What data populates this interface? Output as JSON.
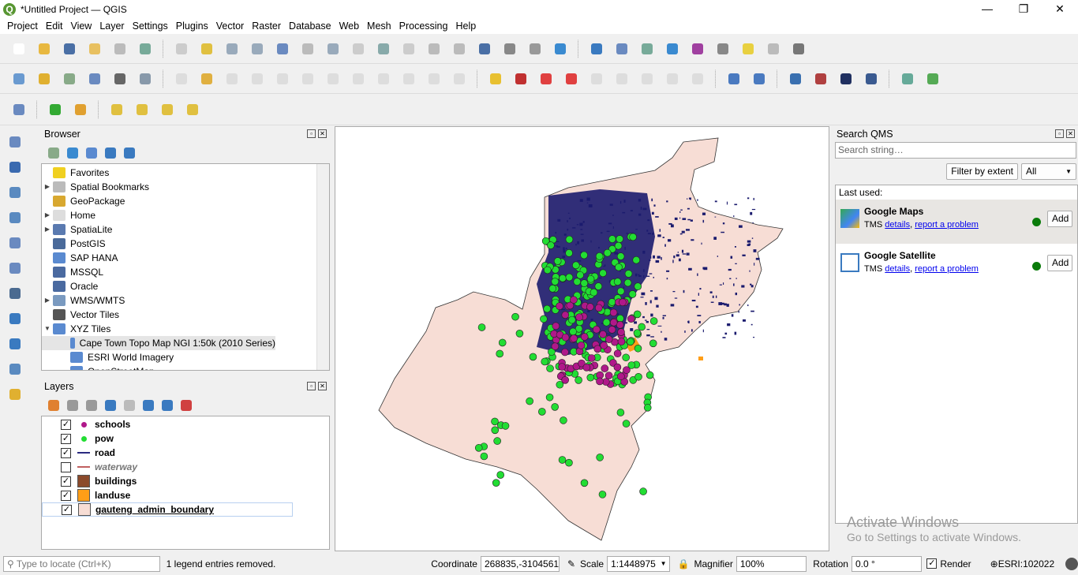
{
  "window": {
    "title": "*Untitled Project — QGIS",
    "minimize": "—",
    "maximize": "❐",
    "close": "✕",
    "logo": "Q"
  },
  "menu": [
    "Project",
    "Edit",
    "View",
    "Layer",
    "Settings",
    "Plugins",
    "Vector",
    "Raster",
    "Database",
    "Web",
    "Mesh",
    "Processing",
    "Help"
  ],
  "toolbars": {
    "row1": [
      [
        "new-project-icon",
        "#fff"
      ],
      [
        "open-project-icon",
        "#e8b840"
      ],
      [
        "save-project-icon",
        "#4a6fa5"
      ],
      [
        "save-as-icon",
        "#e8c060"
      ],
      [
        "print-layout-icon",
        "#bbb"
      ],
      [
        "style-manager-icon",
        "#7a9"
      ],
      "sep",
      [
        "pan-icon",
        "#ccc"
      ],
      [
        "pan-to-selection-icon",
        "#e0c040"
      ],
      [
        "zoom-in-icon",
        "#9ab"
      ],
      [
        "zoom-out-icon",
        "#9ab"
      ],
      [
        "zoom-full-icon",
        "#6a8ac0"
      ],
      [
        "zoom-selection-icon",
        "#bbb"
      ],
      [
        "zoom-layer-icon",
        "#9ab"
      ],
      [
        "zoom-native-icon",
        "#ccc"
      ],
      [
        "zoom-last-icon",
        "#8aa"
      ],
      [
        "zoom-next-icon",
        "#ccc"
      ],
      [
        "new-map-view-icon",
        "#bbb"
      ],
      [
        "new-3d-view-icon",
        "#bbb"
      ],
      [
        "new-bookmark-icon",
        "#4a6fa5"
      ],
      [
        "show-bookmarks-icon",
        "#888"
      ],
      [
        "temporal-icon",
        "#999"
      ],
      [
        "refresh-icon",
        "#3a8ad0"
      ],
      "sep",
      [
        "identify-icon",
        "#3a7ac0"
      ],
      [
        "attribute-table-icon",
        "#6a8ac0"
      ],
      [
        "field-calculator-icon",
        "#7a9"
      ],
      [
        "settings-gear-icon",
        "#3a8ad0"
      ],
      [
        "statistics-sigma-icon",
        "#a040a0"
      ],
      [
        "measure-icon",
        "#888"
      ],
      [
        "annotation-icon",
        "#e8d040"
      ],
      [
        "select-dropdown-icon",
        "#bbb"
      ],
      [
        "text-annotation-icon",
        "#777"
      ]
    ],
    "row2": [
      [
        "digitize-icon",
        "#6a9ad0"
      ],
      [
        "new-geopackage-icon",
        "#e0b030"
      ],
      [
        "new-shapefile-icon",
        "#8a8"
      ],
      [
        "new-spatialite-icon",
        "#6a8ac0"
      ],
      [
        "new-temporary-layer-icon",
        "#666"
      ],
      [
        "new-virtual-layer-icon",
        "#89a"
      ],
      "sep",
      [
        "edits-icon",
        "#bbb",
        "dis"
      ],
      [
        "toggle-editing-icon",
        "#e0b040"
      ],
      [
        "save-edits-icon",
        "#bbb",
        "dis"
      ],
      [
        "add-feature-icon",
        "#bbb",
        "dis"
      ],
      [
        "vertex-tool-icon",
        "#bbb",
        "dis"
      ],
      [
        "modify-attributes-icon",
        "#bbb",
        "dis"
      ],
      [
        "delete-selected-icon",
        "#bbb",
        "dis"
      ],
      [
        "cut-icon",
        "#bbb",
        "dis"
      ],
      [
        "copy-icon",
        "#bbb",
        "dis"
      ],
      [
        "paste-icon",
        "#bbb",
        "dis"
      ],
      [
        "undo-icon",
        "#bbb",
        "dis"
      ],
      [
        "redo-icon",
        "#bbb",
        "dis"
      ],
      "sep",
      [
        "label-icon",
        "#e8c030"
      ],
      [
        "diagram-icon",
        "#c03030"
      ],
      [
        "label-pin-icon",
        "#e04040"
      ],
      [
        "label-highlight-icon",
        "#e04040"
      ],
      [
        "label-show-icon",
        "#bbb",
        "dis"
      ],
      [
        "label-move-icon",
        "#bbb",
        "dis"
      ],
      [
        "label-rotate-icon",
        "#bbb",
        "dis"
      ],
      [
        "label-change-icon",
        "#bbb",
        "dis"
      ],
      [
        "label-preview-icon",
        "#bbb",
        "dis"
      ],
      "sep",
      [
        "wms-add-icon",
        "#4a7ac0"
      ],
      [
        "qms-search-icon",
        "#4a7ac0"
      ],
      "sep",
      [
        "python-icon",
        "#3a70b0"
      ],
      [
        "raster-calc-icon",
        "#b04040"
      ],
      [
        "globe-icon",
        "#203060"
      ],
      [
        "help-icon",
        "#3a5a90"
      ],
      "sep",
      [
        "georeferencer-icon",
        "#6a9"
      ],
      [
        "refresh-plugin-icon",
        "#5a5"
      ]
    ],
    "row3": [
      [
        "chart-icon",
        "#6a8ac0"
      ],
      "sep",
      [
        "processing-toolbox-icon",
        "#3a3"
      ],
      [
        "model-builder-icon",
        "#e0a030"
      ],
      "sep",
      [
        "select-features-icon",
        "#e0c040"
      ],
      [
        "select-by-value-icon",
        "#e0c040"
      ],
      [
        "deselect-icon",
        "#e0c040"
      ],
      [
        "select-location-icon",
        "#e0c040"
      ]
    ],
    "left": [
      [
        "add-vector-layer-icon",
        "#6a8ac0"
      ],
      [
        "add-raster-layer-icon",
        "#3a6ab0"
      ],
      [
        "add-mesh-layer-icon",
        "#5a8ac0"
      ],
      [
        "add-delimited-text-icon",
        "#5a8ac0"
      ],
      [
        "add-spatialite-layer-icon",
        "#6a8ac0"
      ],
      [
        "add-virtual-layer-icon",
        "#6a8ac0"
      ],
      [
        "add-postgis-layer-icon",
        "#4a6a90"
      ],
      [
        "add-wms-layer-icon",
        "#3a7ac0"
      ],
      [
        "add-wfs-layer-icon",
        "#3a7ac0"
      ],
      [
        "add-wcs-layer-icon",
        "#5a8ac0"
      ],
      [
        "add-geopackage-layer-icon",
        "#e0b030"
      ]
    ]
  },
  "browser": {
    "title": "Browser",
    "tools": [
      [
        "add-selected-icon",
        "#8a8"
      ],
      [
        "refresh-icon",
        "#3a8ad0"
      ],
      [
        "filter-icon",
        "#5a8ad0"
      ],
      [
        "collapse-all-icon",
        "#3a7ac0"
      ],
      [
        "info-icon",
        "#3a7ac0"
      ]
    ],
    "items": [
      {
        "label": "Favorites",
        "arrow": "",
        "icon": "#f0d020",
        "name": "favorites"
      },
      {
        "label": "Spatial Bookmarks",
        "arrow": "▶",
        "icon": "#bbb",
        "name": "spatial-bookmarks"
      },
      {
        "label": "GeoPackage",
        "arrow": "",
        "icon": "#d8a830",
        "name": "geopackage"
      },
      {
        "label": "Home",
        "arrow": "▶",
        "icon": "#ddd",
        "name": "home"
      },
      {
        "label": "SpatiaLite",
        "arrow": "▶",
        "icon": "#5a7ab0",
        "name": "spatialite"
      },
      {
        "label": "PostGIS",
        "arrow": "",
        "icon": "#4a6a9a",
        "name": "postgis"
      },
      {
        "label": "SAP HANA",
        "arrow": "",
        "icon": "#5a8ad0",
        "name": "sap-hana"
      },
      {
        "label": "MSSQL",
        "arrow": "",
        "icon": "#4a6aa0",
        "name": "mssql"
      },
      {
        "label": "Oracle",
        "arrow": "",
        "icon": "#4a6aa0",
        "name": "oracle"
      },
      {
        "label": "WMS/WMTS",
        "arrow": "▶",
        "icon": "#7a9ac0",
        "name": "wms-wmts"
      },
      {
        "label": "Vector Tiles",
        "arrow": "",
        "icon": "#555",
        "name": "vector-tiles"
      },
      {
        "label": "XYZ Tiles",
        "arrow": "▼",
        "icon": "#5a8ad0",
        "name": "xyz-tiles"
      }
    ],
    "children": [
      "Cape Town Topo Map NGI 1:50k (2010 Series)",
      "ESRI World Imagery",
      "OpenStreetMap"
    ]
  },
  "layers": {
    "title": "Layers",
    "tools": [
      [
        "style-panel-icon",
        "#e08030"
      ],
      [
        "add-group-icon",
        "#999"
      ],
      [
        "visibility-icon",
        "#999"
      ],
      [
        "filter-legend-icon",
        "#3a7ac0"
      ],
      [
        "expression-filter-icon",
        "#bbb"
      ],
      [
        "expand-all-icon",
        "#3a7ac0"
      ],
      [
        "collapse-all-icon",
        "#3a7ac0"
      ],
      [
        "remove-layer-icon",
        "#d04040"
      ]
    ],
    "items": [
      {
        "name": "schools",
        "checked": true,
        "symbol": "point",
        "color": "#b0188a"
      },
      {
        "name": "pow",
        "checked": true,
        "symbol": "point",
        "color": "#22dd33"
      },
      {
        "name": "road",
        "checked": true,
        "symbol": "line",
        "color": "#2a2a80"
      },
      {
        "name": "waterway",
        "checked": false,
        "symbol": "line",
        "color": "#c06060"
      },
      {
        "name": "buildings",
        "checked": true,
        "symbol": "fill",
        "color": "#8b4a2b"
      },
      {
        "name": "landuse",
        "checked": true,
        "symbol": "fill",
        "color": "#ff9e17"
      },
      {
        "name": "gauteng_admin_boundary",
        "checked": true,
        "symbol": "fill",
        "color": "#f7ddd5"
      }
    ]
  },
  "map": {
    "boundary_fill": "#f7ddd5",
    "road_color": "#1b1b6e",
    "schools_color": "#b0188a",
    "pow_color": "#22dd33",
    "landuse_color": "#ff9e17"
  },
  "qms": {
    "title": "Search QMS",
    "search_placeholder": "Search string…",
    "filter_button": "Filter by extent",
    "filter_value": "All",
    "last_used": "Last used:",
    "services": [
      {
        "name": "Google Maps",
        "type": "TMS",
        "details": "details",
        "report": "report a problem",
        "add": "Add",
        "status_color": "#0a7b0a"
      },
      {
        "name": "Google Satellite",
        "type": "TMS",
        "details": "details",
        "report": "report a problem",
        "add": "Add",
        "status_color": "#0a7b0a"
      }
    ]
  },
  "watermark": {
    "line1": "Activate Windows",
    "line2": "Go to Settings to activate Windows."
  },
  "status": {
    "locate_placeholder": "Type to locate (Ctrl+K)",
    "message": "1 legend entries removed.",
    "coordinate_label": "Coordinate",
    "coordinate": "268835,-3104561",
    "scale_label": "Scale",
    "scale": "1:1448975",
    "magnifier_label": "Magnifier",
    "magnifier": "100%",
    "rotation_label": "Rotation",
    "rotation": "0.0 °",
    "render_label": "Render",
    "render": true,
    "crs": "ESRI:102022"
  }
}
